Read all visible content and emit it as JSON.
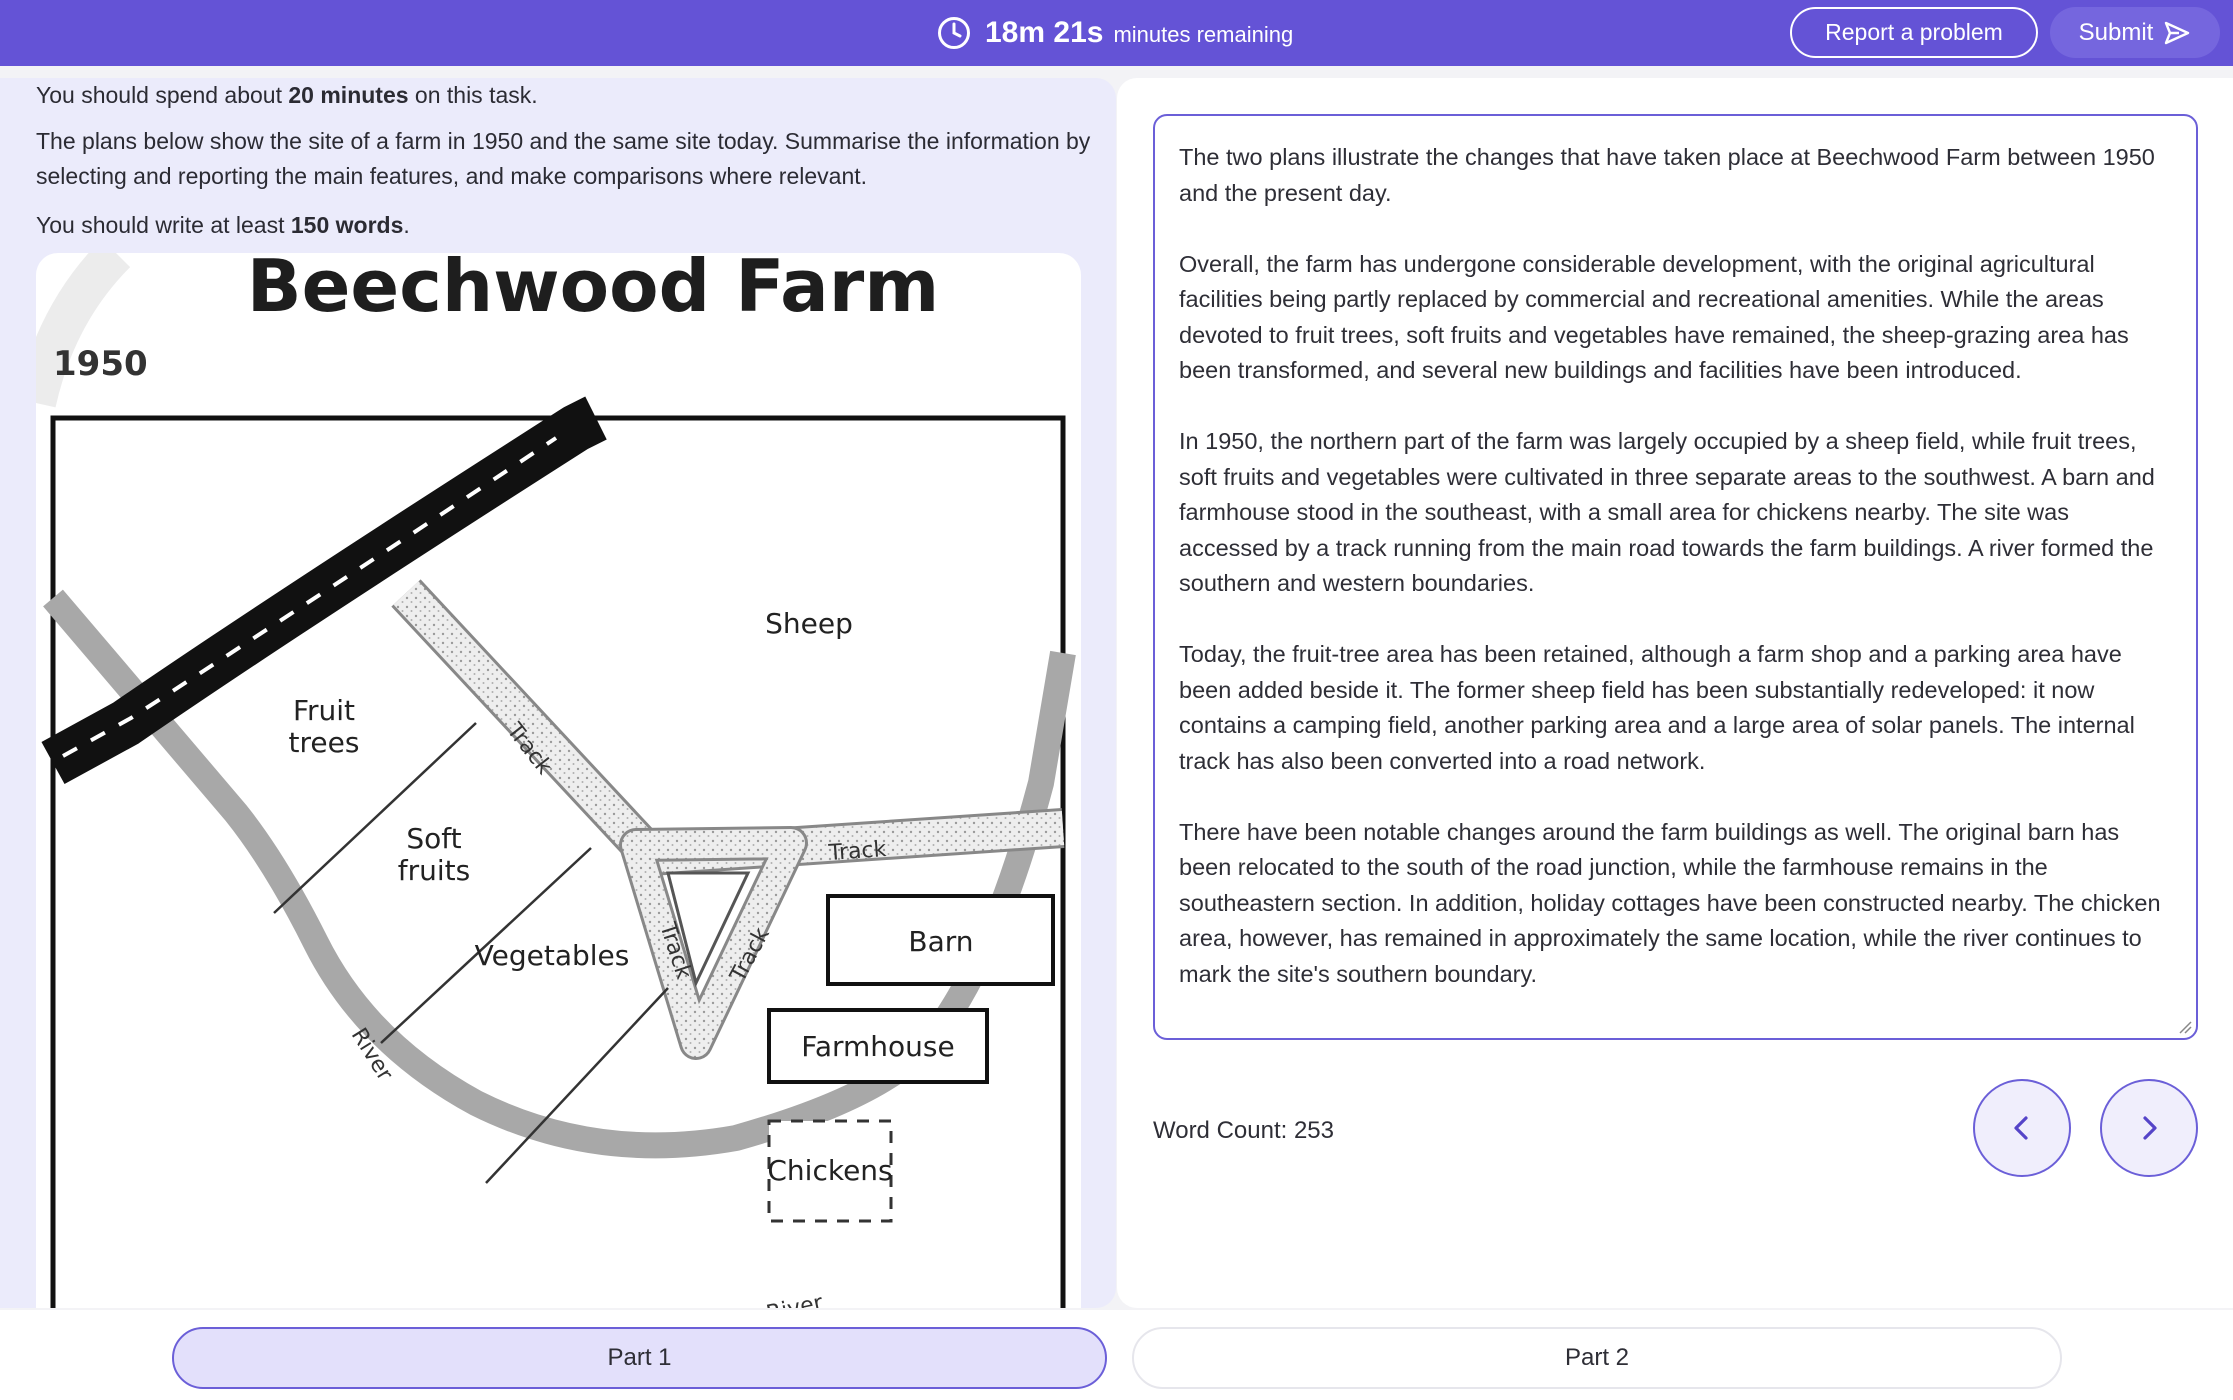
{
  "header": {
    "timer_value": "18m 21s",
    "timer_suffix": "minutes remaining",
    "timer_icon": "clock-icon",
    "report_label": "Report a problem",
    "submit_label": "Submit",
    "submit_icon": "send-icon",
    "accent_color": "#6453d6"
  },
  "task": {
    "time_prefix": "You should spend about ",
    "time_strong": "20 minutes",
    "time_suffix": " on this task.",
    "prompt": "The plans below show the site of a farm in 1950 and the same site today. Summarise the information by selecting and reporting the main features, and make comparisons where relevant.",
    "words_prefix": "You should write at least ",
    "words_strong": "150 words",
    "words_suffix": "."
  },
  "map": {
    "title": "Beechwood Farm",
    "year": "1950",
    "labels": {
      "sheep": "Sheep",
      "fruit_trees_1": "Fruit",
      "fruit_trees_2": "trees",
      "soft_fruits_1": "Soft",
      "soft_fruits_2": "fruits",
      "vegetables": "Vegetables",
      "barn": "Barn",
      "farmhouse": "Farmhouse",
      "chickens": "Chickens",
      "track_a": "Track",
      "track_b": "Track",
      "track_c": "Track",
      "track_d": "Track",
      "river_a": "River",
      "river_b": "River"
    }
  },
  "essay": {
    "paragraphs": [
      "The two plans illustrate the changes that have taken place at Beechwood Farm between 1950 and the present day.",
      "Overall, the farm has undergone considerable development, with the original agricultural facilities being partly replaced by commercial and recreational amenities. While the areas devoted to fruit trees, soft fruits and vegetables have remained, the sheep-grazing area has been transformed, and several new buildings and facilities have been introduced.",
      "In 1950, the northern part of the farm was largely occupied by a sheep field, while fruit trees, soft fruits and vegetables were cultivated in three separate areas to the southwest. A barn and farmhouse stood in the southeast, with a small area for chickens nearby. The site was accessed by a track running from the main road towards the farm buildings. A river formed the southern and western boundaries.",
      "Today, the fruit-tree area has been retained, although a farm shop and a parking area have been added beside it. The former sheep field has been substantially redeveloped: it now contains a camping field, another parking area and a large area of solar panels. The internal track has also been converted into a road network.",
      "There have been notable changes around the farm buildings as well. The original barn has been relocated to the south of the road junction, while the farmhouse remains in the southeastern section. In addition, holiday cottages have been constructed nearby. The chicken area, however, has remained in approximately the same location, while the river continues to mark the site's southern boundary."
    ],
    "word_count_label": "Word Count: 253"
  },
  "navigation": {
    "prev_icon": "chevron-left-icon",
    "next_icon": "chevron-right-icon"
  },
  "parts": {
    "part1_label": "Part 1",
    "part2_label": "Part 2",
    "active": "Part 1"
  }
}
